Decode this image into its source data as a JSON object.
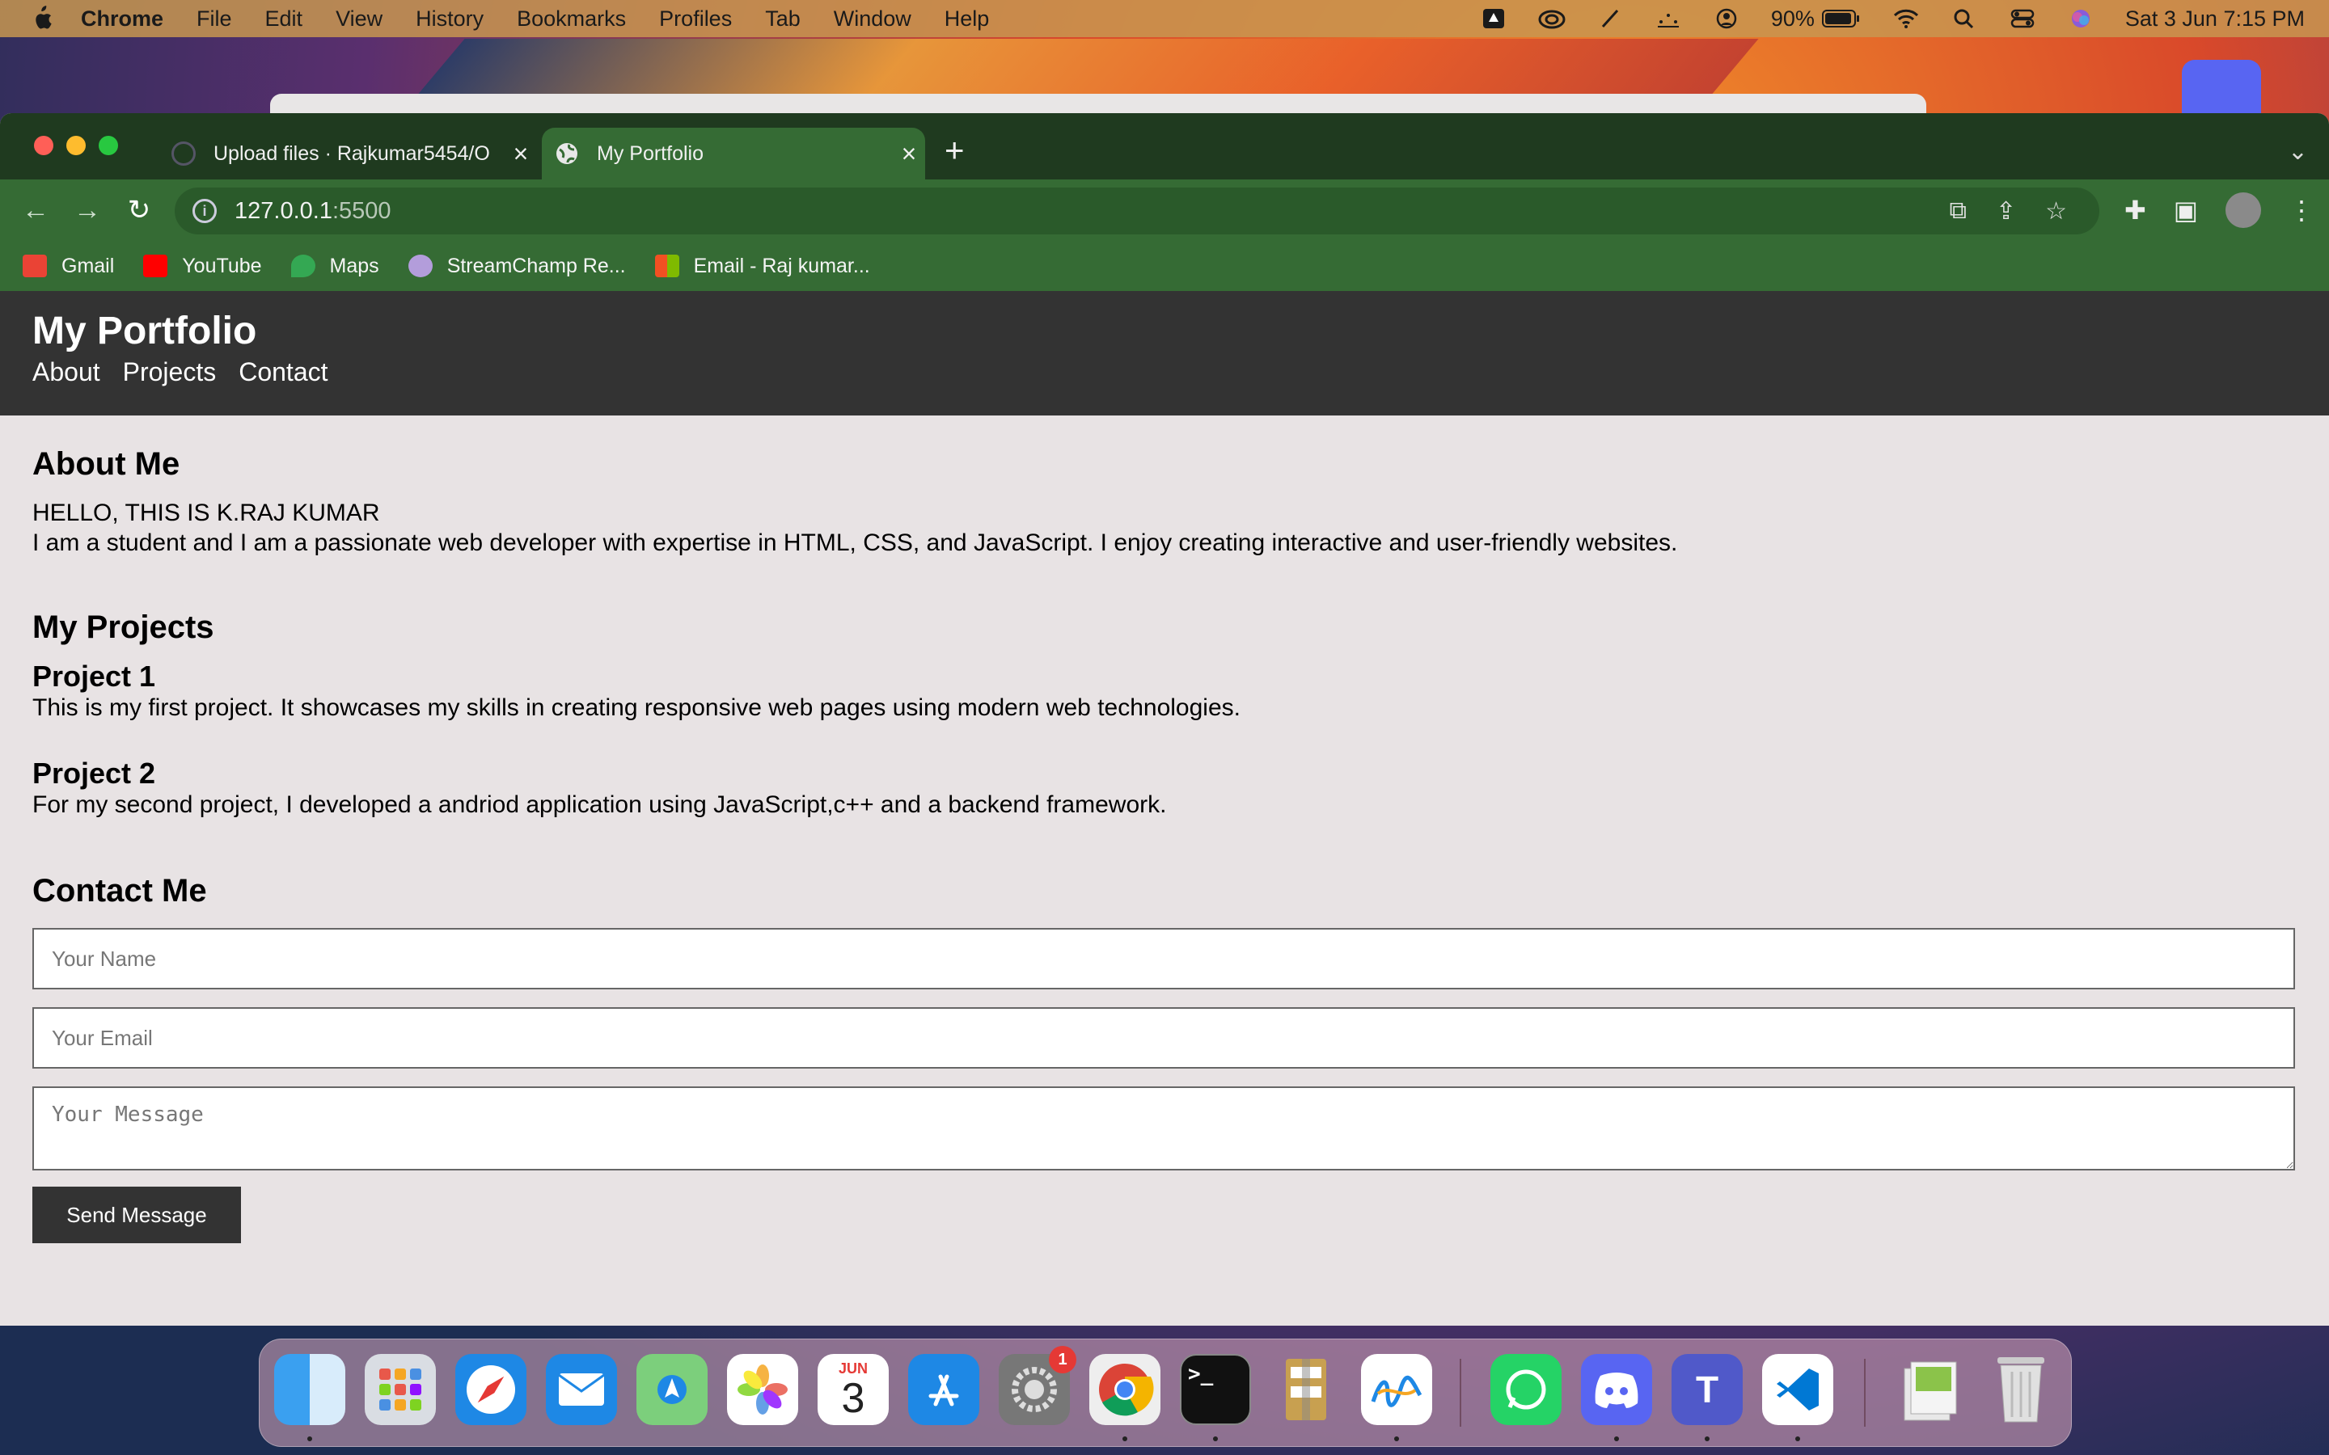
{
  "menubar": {
    "app_name": "Chrome",
    "items": [
      "File",
      "Edit",
      "View",
      "History",
      "Bookmarks",
      "Profiles",
      "Tab",
      "Window",
      "Help"
    ],
    "battery": "90%",
    "clock": "Sat 3 Jun  7:15 PM"
  },
  "browser": {
    "tabs": [
      {
        "title": "Upload files · Rajkumar5454/O",
        "active": false
      },
      {
        "title": "My Portfolio",
        "active": true
      }
    ],
    "url_host": "127.0.0.1",
    "url_port": ":5500",
    "bookmarks": [
      {
        "label": "Gmail",
        "icon": "gmail-icon",
        "color": "#ea4335"
      },
      {
        "label": "YouTube",
        "icon": "youtube-icon",
        "color": "#ff0000"
      },
      {
        "label": "Maps",
        "icon": "maps-icon",
        "color": "#34a853"
      },
      {
        "label": "StreamChamp Re...",
        "icon": "streamchamp-icon",
        "color": "#b39ddb"
      },
      {
        "label": "Email - Raj kumar...",
        "icon": "microsoft-icon",
        "color": "#f25022"
      }
    ]
  },
  "site": {
    "title": "My Portfolio",
    "nav": [
      "About",
      "Projects",
      "Contact"
    ],
    "about": {
      "heading": "About Me",
      "line1": "HELLO, THIS IS K.RAJ KUMAR",
      "line2": "I am a student and I am a passionate web developer with expertise in HTML, CSS, and JavaScript. I enjoy creating interactive and user-friendly websites."
    },
    "projects": {
      "heading": "My Projects",
      "items": [
        {
          "title": "Project 1",
          "desc": "This is my first project. It showcases my skills in creating responsive web pages using modern web technologies."
        },
        {
          "title": "Project 2",
          "desc": "For my second project, I developed a andriod application using JavaScript,c++ and a backend framework."
        }
      ]
    },
    "contact": {
      "heading": "Contact Me",
      "name_placeholder": "Your Name",
      "email_placeholder": "Your Email",
      "message_placeholder": "Your Message",
      "send_label": "Send Message"
    }
  },
  "dock": {
    "calendar_month": "JUN",
    "calendar_day": "3",
    "settings_badge": "1",
    "terminal_prompt": ">_"
  }
}
